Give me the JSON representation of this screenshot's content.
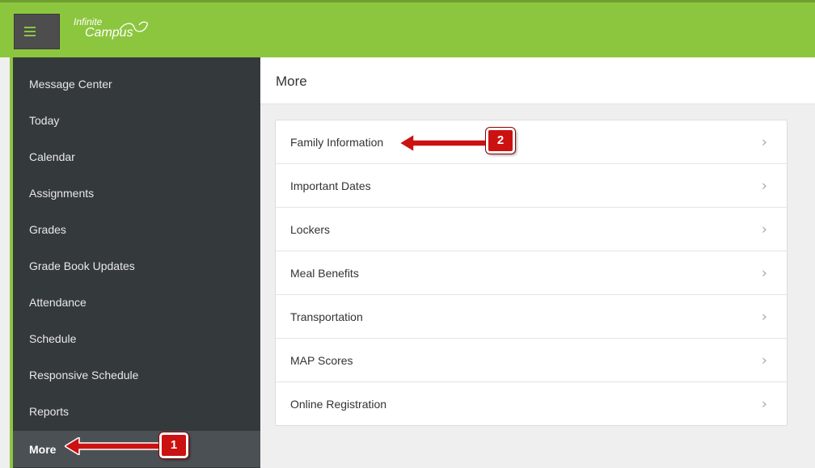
{
  "header": {
    "brand_line1": "Infinite",
    "brand_line2": "Campus",
    "menu_icon": "hamburger-icon",
    "accent_color": "#8cc63f"
  },
  "sidebar": {
    "items": [
      {
        "label": "Message Center",
        "active": false
      },
      {
        "label": "Today",
        "active": false
      },
      {
        "label": "Calendar",
        "active": false
      },
      {
        "label": "Assignments",
        "active": false
      },
      {
        "label": "Grades",
        "active": false
      },
      {
        "label": "Grade Book Updates",
        "active": false
      },
      {
        "label": "Attendance",
        "active": false
      },
      {
        "label": "Schedule",
        "active": false
      },
      {
        "label": "Responsive Schedule",
        "active": false
      },
      {
        "label": "Reports",
        "active": false
      },
      {
        "label": "More",
        "active": true
      }
    ]
  },
  "main": {
    "title": "More",
    "items": [
      {
        "label": "Family Information",
        "icon": "chevron-right-icon"
      },
      {
        "label": "Important Dates",
        "icon": "chevron-right-icon"
      },
      {
        "label": "Lockers",
        "icon": "chevron-right-icon"
      },
      {
        "label": "Meal Benefits",
        "icon": "chevron-right-icon"
      },
      {
        "label": "Transportation",
        "icon": "chevron-right-icon"
      },
      {
        "label": "MAP Scores",
        "icon": "chevron-right-icon"
      },
      {
        "label": "Online Registration",
        "icon": "chevron-right-icon"
      }
    ],
    "chevron": "›"
  },
  "annotations": [
    {
      "number": "1",
      "target": "More"
    },
    {
      "number": "2",
      "target": "Family Information"
    }
  ]
}
